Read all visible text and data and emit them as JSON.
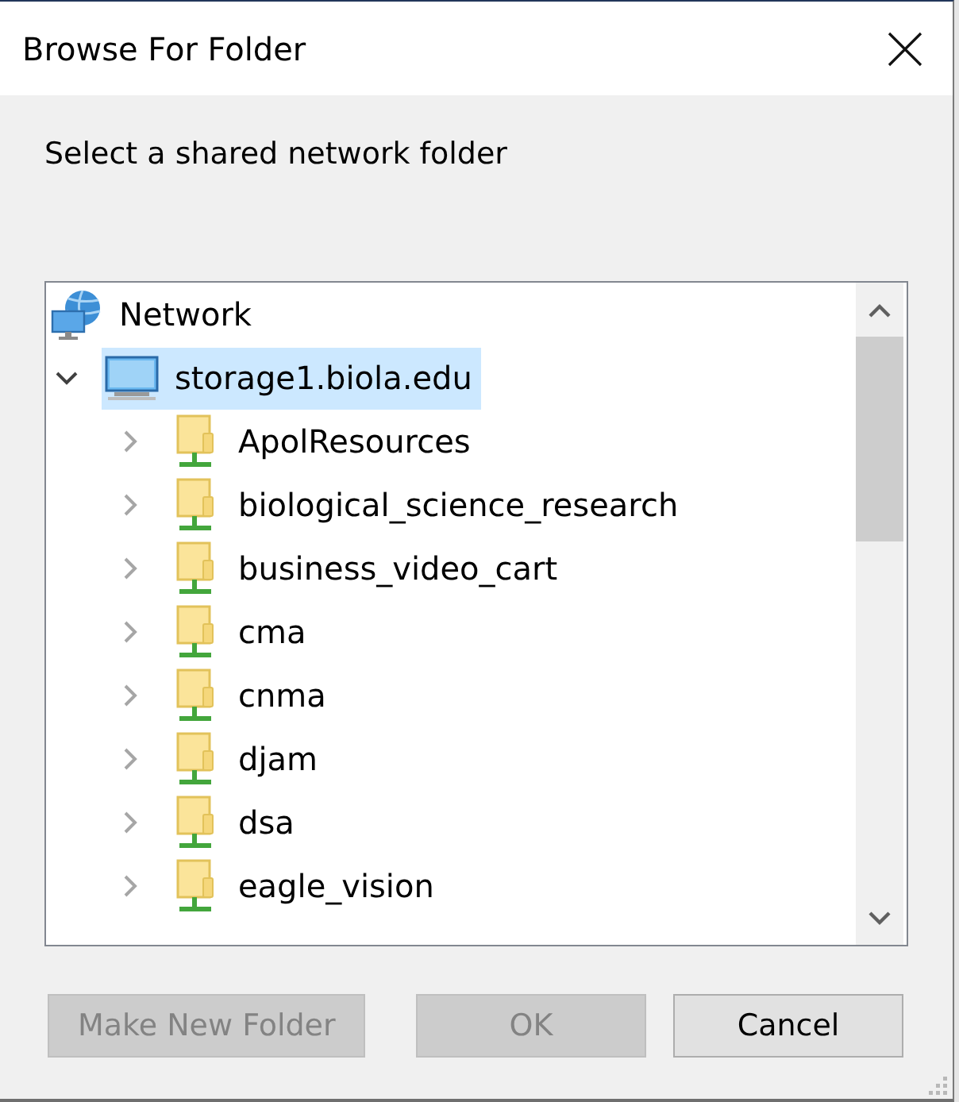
{
  "window": {
    "title": "Browse For Folder"
  },
  "instruction": "Select a shared network folder",
  "tree": {
    "items": [
      {
        "label": "Network",
        "kind": "network",
        "selected": false,
        "children": [
          {
            "label": "storage1.biola.edu",
            "kind": "computer",
            "expanded": true,
            "selected": true,
            "children": [
              {
                "label": "ApolResources",
                "kind": "share",
                "expanded": false,
                "selected": false
              },
              {
                "label": "biological_science_research",
                "kind": "share",
                "expanded": false,
                "selected": false
              },
              {
                "label": "business_video_cart",
                "kind": "share",
                "expanded": false,
                "selected": false
              },
              {
                "label": "cma",
                "kind": "share",
                "expanded": false,
                "selected": false
              },
              {
                "label": "cnma",
                "kind": "share",
                "expanded": false,
                "selected": false
              },
              {
                "label": "djam",
                "kind": "share",
                "expanded": false,
                "selected": false
              },
              {
                "label": "dsa",
                "kind": "share",
                "expanded": false,
                "selected": false
              },
              {
                "label": "eagle_vision",
                "kind": "share",
                "expanded": false,
                "selected": false
              }
            ]
          }
        ]
      }
    ]
  },
  "buttons": [
    {
      "label": "Make New Folder",
      "disabled": true
    },
    {
      "label": "OK",
      "disabled": true
    },
    {
      "label": "Cancel",
      "disabled": false
    }
  ]
}
